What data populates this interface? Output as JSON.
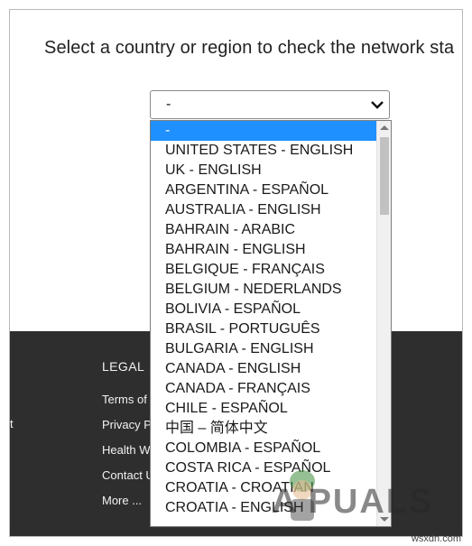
{
  "heading": "Select a country or region to check the network sta",
  "select": {
    "value": "-"
  },
  "footer": {
    "legal_title": "LEGAL",
    "links": [
      "Terms of",
      "Privacy P",
      "Health W",
      "Contact U",
      "More ..."
    ],
    "edge_char": "t"
  },
  "options": [
    "-",
    "UNITED STATES - ENGLISH",
    "UK - ENGLISH",
    "ARGENTINA - ESPAÑOL",
    "AUSTRALIA - ENGLISH",
    "BAHRAIN - ARABIC",
    "BAHRAIN - ENGLISH",
    "BELGIQUE - FRANÇAIS",
    "BELGIUM - NEDERLANDS",
    "BOLIVIA - ESPAÑOL",
    "BRASIL - PORTUGUÊS",
    "BULGARIA - ENGLISH",
    "CANADA - ENGLISH",
    "CANADA - FRANÇAIS",
    "CHILE - ESPAÑOL",
    "中国 – 简体中文",
    "COLOMBIA - ESPAÑOL",
    "COSTA RICA - ESPAÑOL",
    "CROATIA - CROATIAN",
    "CROATIA - ENGLISH"
  ],
  "selected_index": 0,
  "watermark": "A PUALS",
  "site_label": "wsxdn.com",
  "colors": {
    "highlight": "#1e90ff",
    "footer_bg": "#2e2e2e"
  },
  "icons": {
    "select_arrow": "chevron-down-icon",
    "scroll_up": "triangle-up-icon",
    "scroll_down": "triangle-down-icon"
  }
}
